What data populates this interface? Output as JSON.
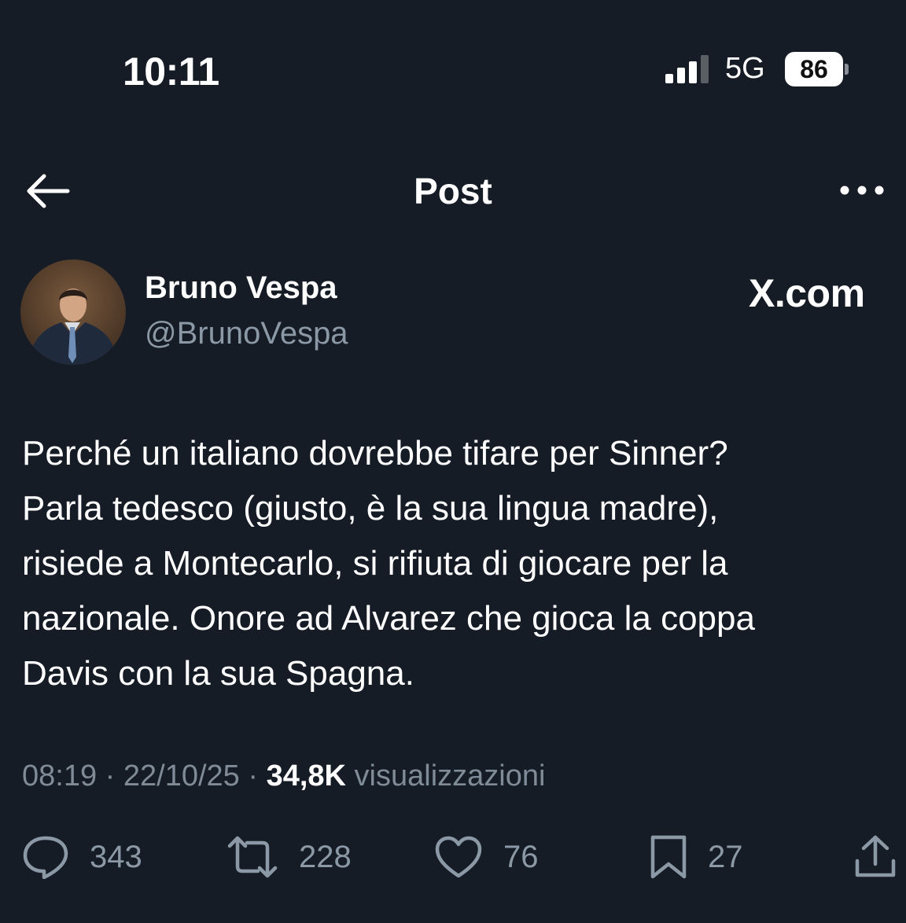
{
  "status_bar": {
    "time": "10:11",
    "network": "5G",
    "battery": "86"
  },
  "header": {
    "title": "Post"
  },
  "author": {
    "name": "Bruno Vespa",
    "handle": "@BrunoVespa",
    "brand": "X.com"
  },
  "post": {
    "lines": [
      "Perché un italiano dovrebbe tifare per Sinner?",
      "Parla tedesco (giusto, è la sua lingua madre),",
      "risiede a Montecarlo, si rifiuta di giocare per la",
      "nazionale. Onore ad Alvarez che gioca la coppa",
      "Davis con la sua Spagna."
    ],
    "time": "08:19",
    "date": "22/10/25",
    "views": "34,8K",
    "views_label": "visualizzazioni"
  },
  "actions": {
    "replies": "343",
    "reposts": "228",
    "likes": "76",
    "bookmarks": "27"
  },
  "icons": [
    "back-arrow-icon",
    "more-options-icon",
    "reply-icon",
    "repost-icon",
    "like-icon",
    "bookmark-icon",
    "share-icon"
  ]
}
